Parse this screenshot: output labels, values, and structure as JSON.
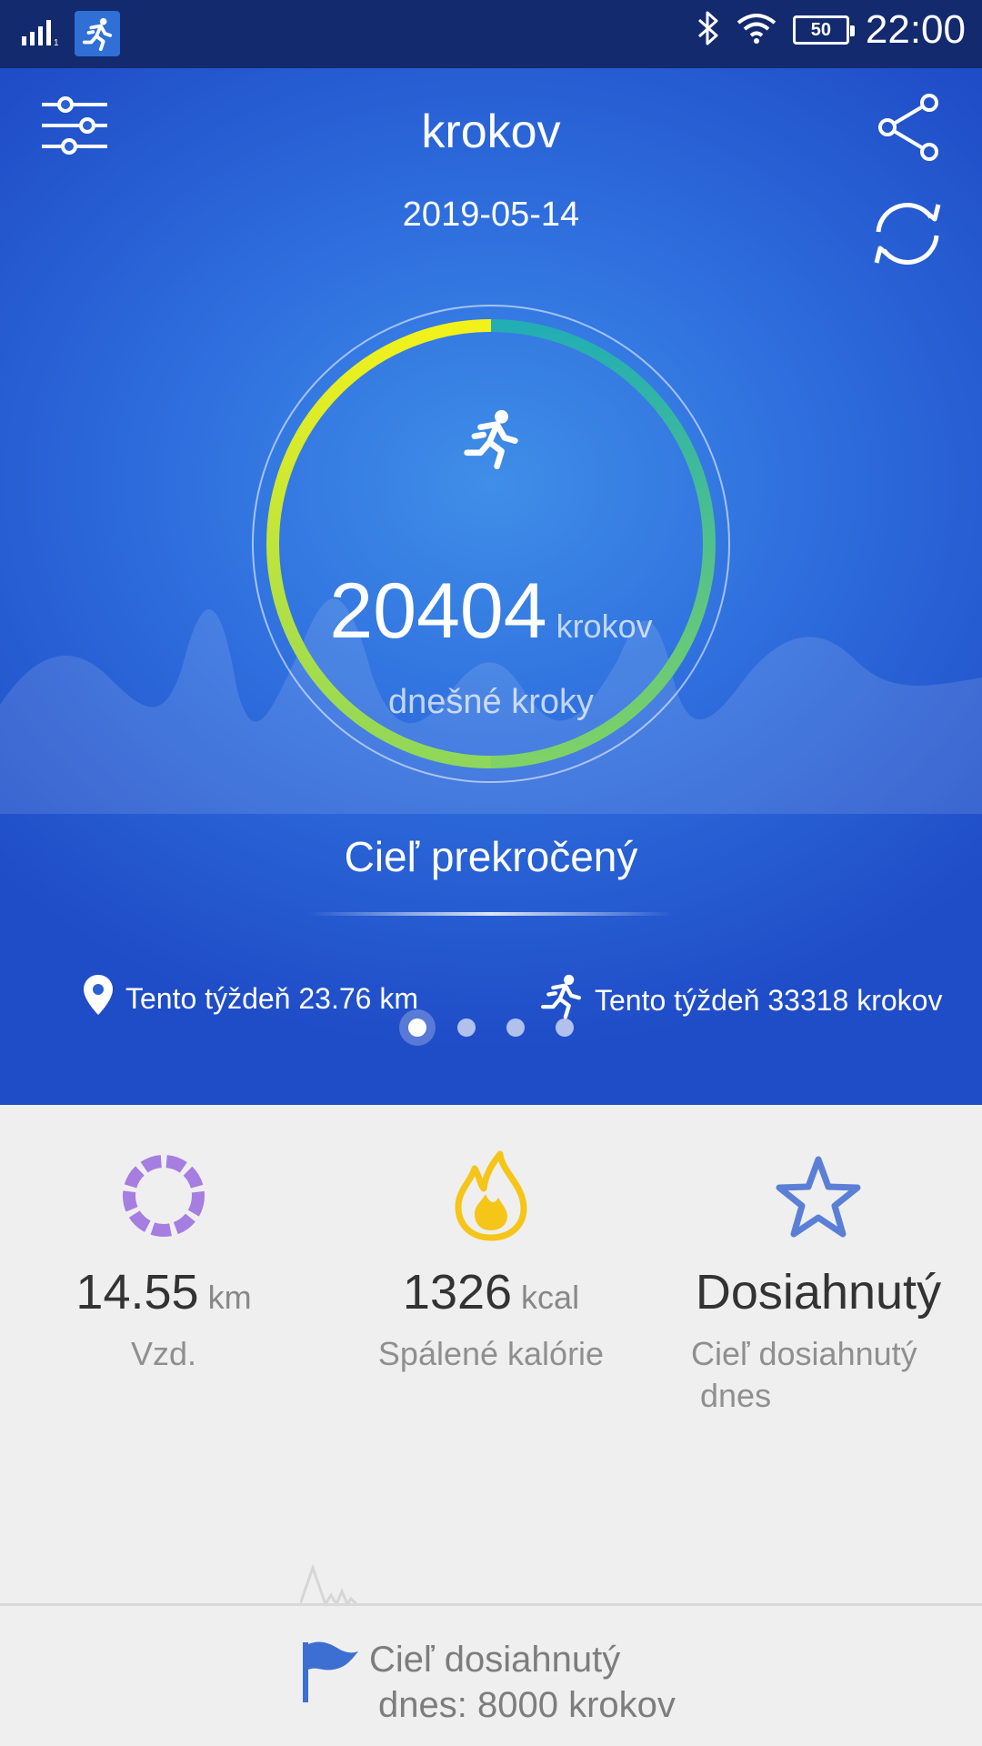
{
  "status_bar": {
    "time": "22:00",
    "battery": "50",
    "signal": "signal-icon",
    "wifi": "wifi-icon",
    "bluetooth": "bluetooth-icon"
  },
  "header": {
    "title": "krokov",
    "date": "2019-05-14",
    "settings_icon": "sliders-icon",
    "share_icon": "share-icon",
    "sync_icon": "sync-icon"
  },
  "ring": {
    "steps": "20404",
    "unit": "krokov",
    "label": "dnešné kroky",
    "progress": 1.0,
    "colors": {
      "start": "#e8f020",
      "end": "#2eb3b0",
      "track": "#8ed25a"
    }
  },
  "goal": {
    "status": "Cieľ prekročený"
  },
  "week": {
    "distance": "Tento týždeň 23.76 km",
    "steps": "Tento týždeň 33318 krokov"
  },
  "pager": {
    "count": 4,
    "active": 0
  },
  "stats": [
    {
      "value": "14.55",
      "unit": "km",
      "label": "Vzd.",
      "icon": "distance-ring-icon",
      "color": "#a67de0"
    },
    {
      "value": "1326",
      "unit": "kcal",
      "label": "Spálené kalórie",
      "icon": "flame-icon",
      "color": "#f5c518"
    },
    {
      "value": "Dosiahnutý",
      "label_line1": "Cieľ dosiahnutý",
      "label_line2": "dnes",
      "icon": "star-icon",
      "color": "#5b7fd6"
    }
  ],
  "footer": {
    "line1": "Cieľ dosiahnutý",
    "line2": "dnes: 8000 krokov",
    "icon": "flag-icon",
    "color": "#3d6fd3"
  }
}
